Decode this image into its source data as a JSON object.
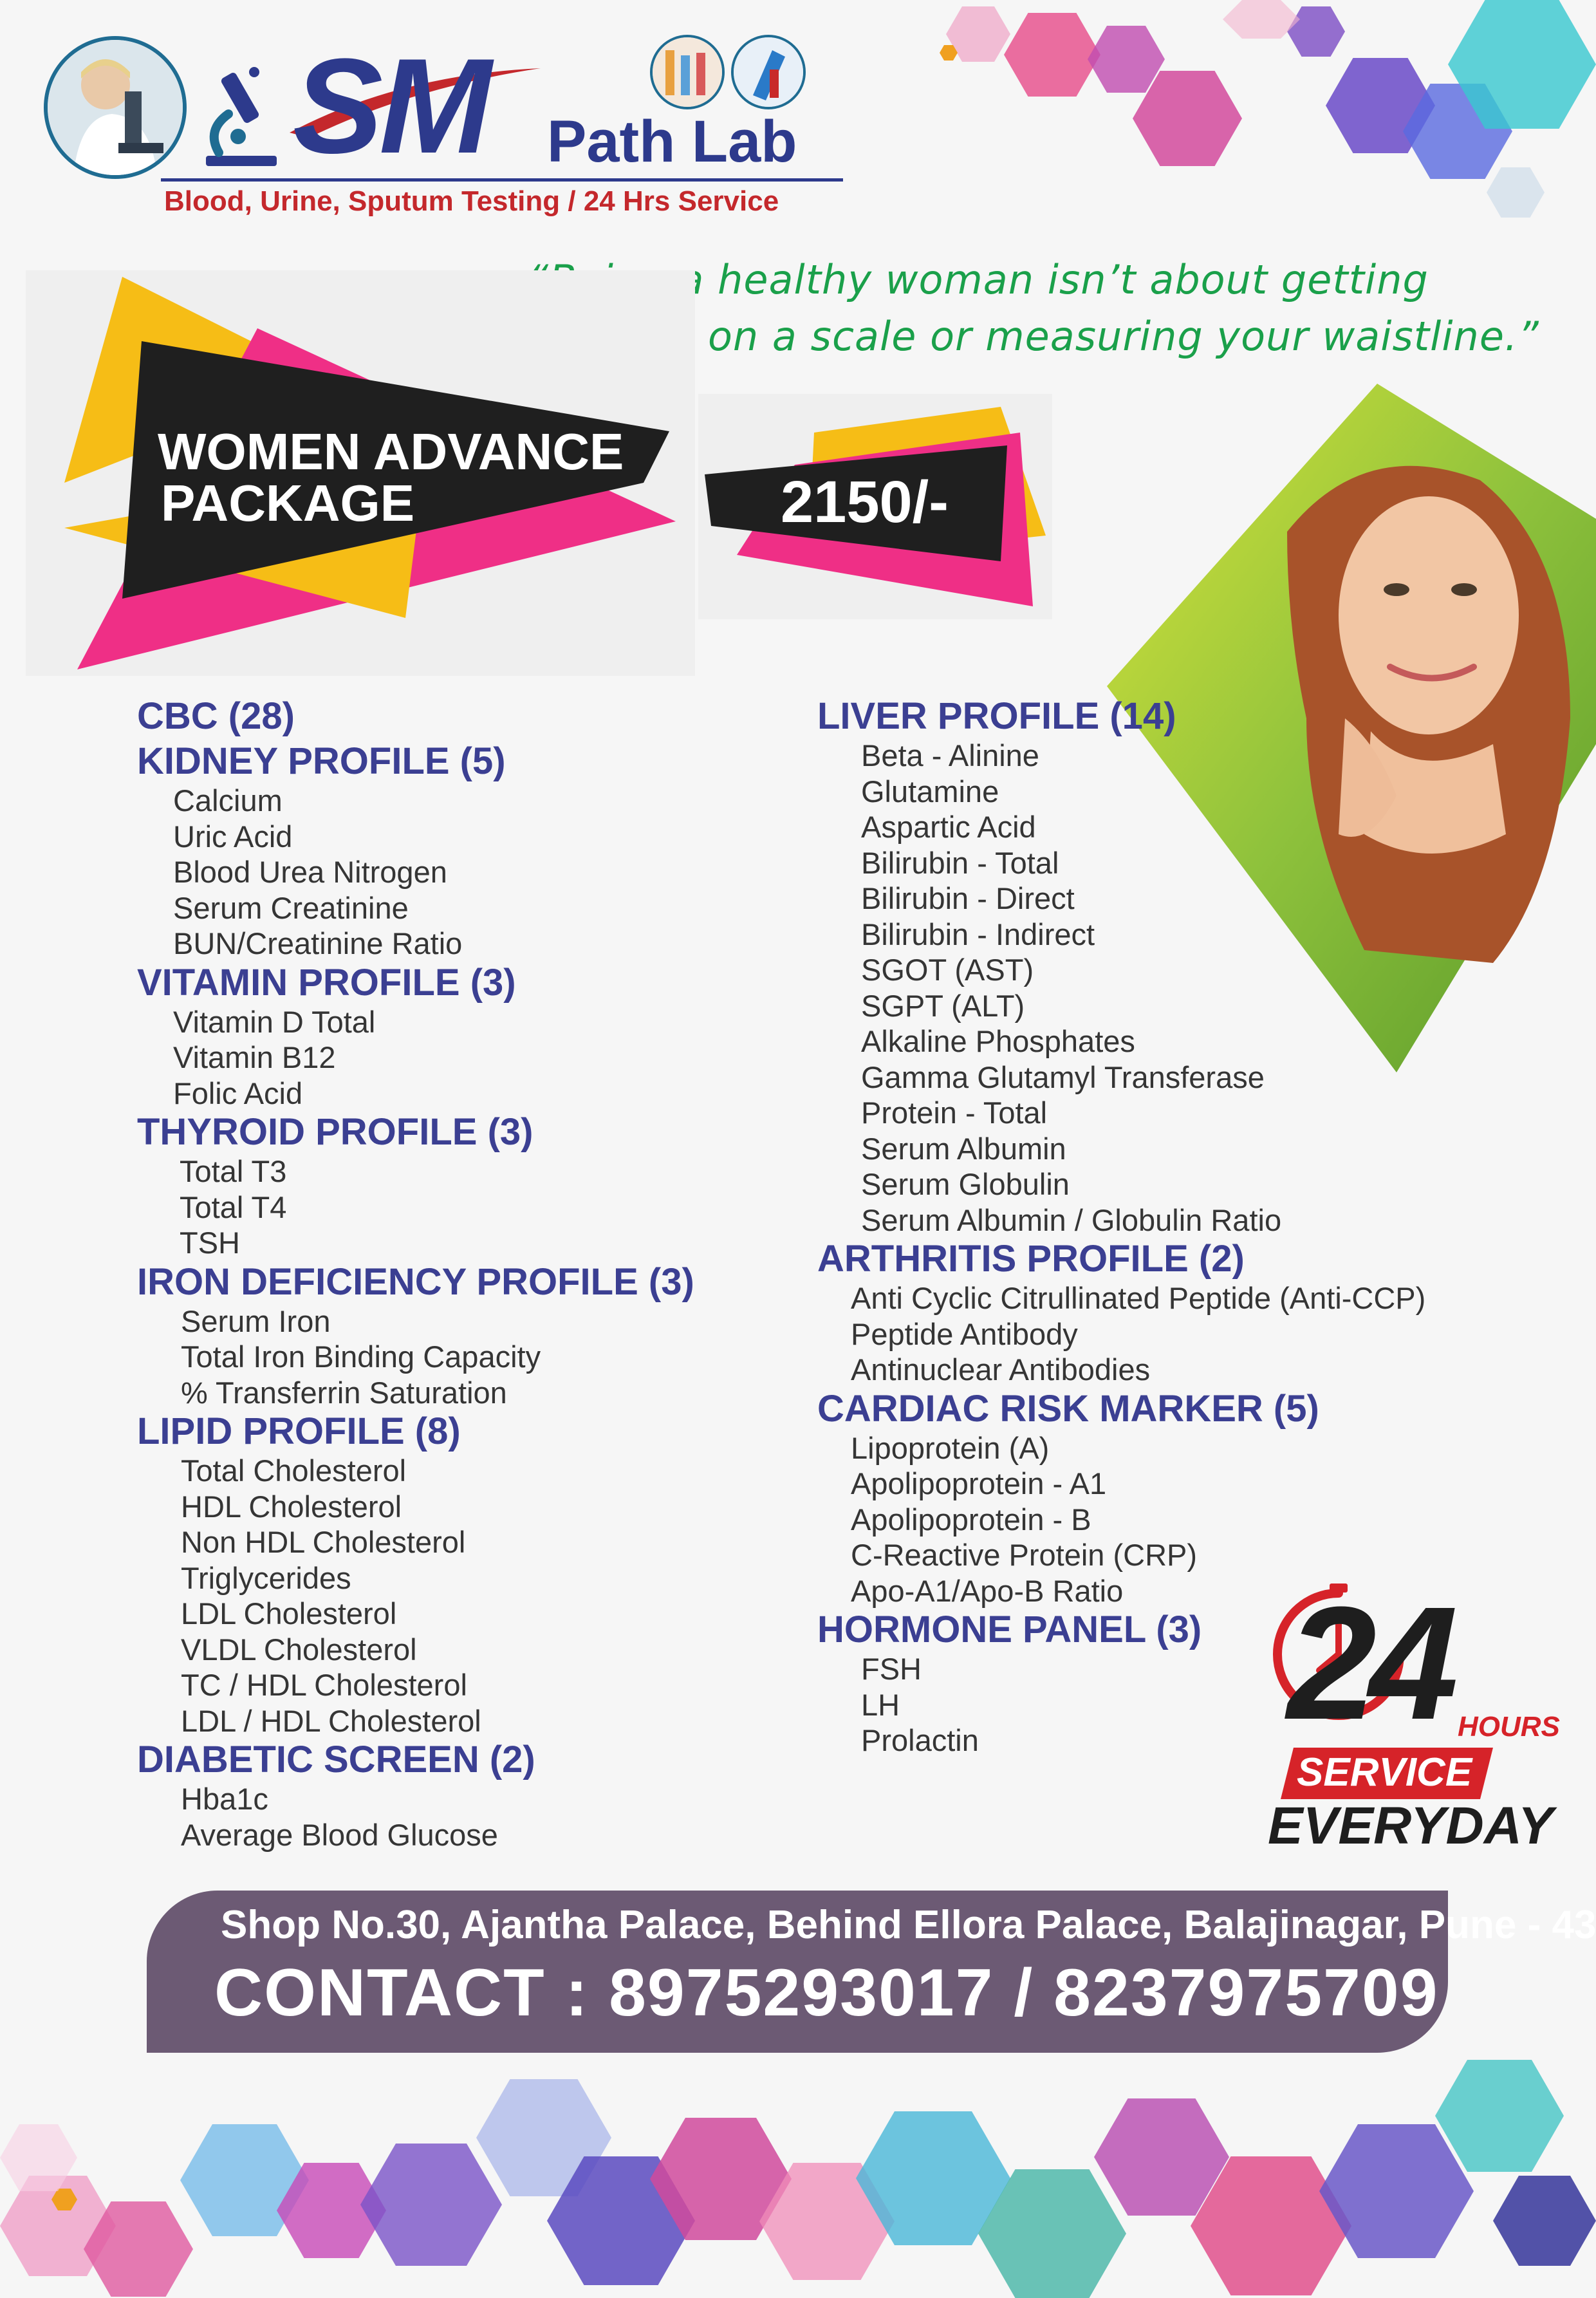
{
  "header": {
    "logo_text": "SM",
    "brand_name": "Path Lab",
    "tagline": "Blood, Urine, Sputum Testing / 24 Hrs Service"
  },
  "quote": {
    "line1": "“Being a healthy woman isn’t about getting",
    "line2": "on a scale or measuring your waistline.”"
  },
  "package": {
    "title_line1": "WOMEN ADVANCE",
    "title_line2": "PACKAGE",
    "price": "2150/-"
  },
  "left_sections": [
    {
      "title": "CBC (28)",
      "items": []
    },
    {
      "title": "KIDNEY PROFILE (5)",
      "items": [
        "Calcium",
        "Uric Acid",
        "Blood Urea Nitrogen",
        "Serum Creatinine",
        "BUN/Creatinine Ratio"
      ]
    },
    {
      "title": "VITAMIN PROFILE (3)",
      "items": [
        "Vitamin D Total",
        "Vitamin B12",
        "Folic Acid"
      ]
    },
    {
      "title": "THYROID PROFILE (3)",
      "items": [
        "Total T3",
        "Total T4",
        "TSH"
      ]
    },
    {
      "title": "IRON DEFICIENCY PROFILE (3)",
      "items": [
        "Serum Iron",
        "Total Iron Binding Capacity",
        "% Transferrin Saturation"
      ]
    },
    {
      "title": "LIPID PROFILE (8)",
      "items": [
        "Total Cholesterol",
        "HDL Cholesterol",
        "Non HDL Cholesterol",
        "Triglycerides",
        "LDL Cholesterol",
        "VLDL Cholesterol",
        "TC / HDL Cholesterol",
        "LDL / HDL Cholesterol"
      ]
    },
    {
      "title": "DIABETIC SCREEN (2)",
      "items": [
        "Hba1c",
        "Average Blood Glucose"
      ]
    }
  ],
  "right_sections": [
    {
      "title": "LIVER PROFILE (14)",
      "items": [
        "Beta - Alinine",
        "Glutamine",
        "Aspartic Acid",
        "Bilirubin - Total",
        "Bilirubin - Direct",
        "Bilirubin - Indirect",
        "SGOT (AST)",
        "SGPT (ALT)",
        "Alkaline Phosphates",
        "Gamma Glutamyl Transferase",
        "Protein - Total",
        "Serum Albumin",
        "Serum Globulin",
        "Serum Albumin / Globulin Ratio"
      ]
    },
    {
      "title": "ARTHRITIS PROFILE (2)",
      "items": [
        "Anti Cyclic Citrullinated Peptide (Anti-CCP)",
        "Peptide Antibody",
        "Antinuclear Antibodies"
      ]
    },
    {
      "title": "CARDIAC RISK MARKER (5)",
      "items": [
        "Lipoprotein (A)",
        "Apolipoprotein - A1",
        "Apolipoprotein - B",
        "C-Reactive Protein (CRP)",
        "Apo-A1/Apo-B Ratio"
      ]
    },
    {
      "title": "HORMONE PANEL (3)",
      "items": [
        "FSH",
        "LH",
        "Prolactin"
      ]
    }
  ],
  "badge": {
    "number": "24",
    "hours": "HOURS",
    "service": "SERVICE",
    "everyday": "EVERYDAY"
  },
  "footer": {
    "address": "Shop No.30, Ajantha Palace, Behind Ellora Palace, Balajinagar, Pune - 43",
    "contact": "CONTACT : 8975293017 / 8237975709"
  },
  "colors": {
    "heading_blue": "#3b3f92",
    "quote_green": "#1aa04a",
    "accent_pink": "#ef2f86",
    "accent_yellow": "#f6bd16",
    "banner_dark": "#1f1f1f",
    "footer_purple": "#6c5a74",
    "badge_red": "#d62329"
  },
  "icons": [
    "microscope-icon",
    "scientist-photo",
    "test-tubes-photo",
    "blood-sample-photo",
    "woman-photo",
    "clock-icon"
  ]
}
